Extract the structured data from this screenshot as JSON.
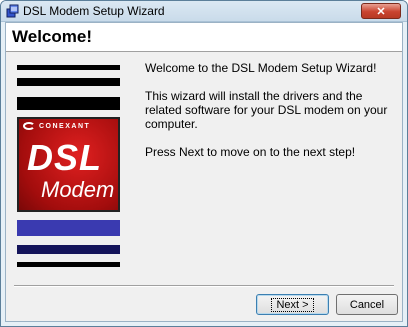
{
  "window": {
    "title": "DSL Modem Setup Wizard",
    "close_label": "✕"
  },
  "header": {
    "title": "Welcome!"
  },
  "logo": {
    "brand": "CONEXANT",
    "line1": "DSL",
    "line2": "Modem"
  },
  "content": {
    "paragraphs": [
      "Welcome to the DSL Modem Setup Wizard!",
      "This wizard will install the drivers and the related software for your DSL modem on your computer.",
      "Press Next to move on to the next step!"
    ]
  },
  "buttons": {
    "next_label": "Next >",
    "cancel_label": "Cancel"
  },
  "colors": {
    "logo_red": "#c01414",
    "bar_black": "#000000",
    "bar_blue": "#3a3ab0",
    "accent_border": "#3c7fb1"
  }
}
